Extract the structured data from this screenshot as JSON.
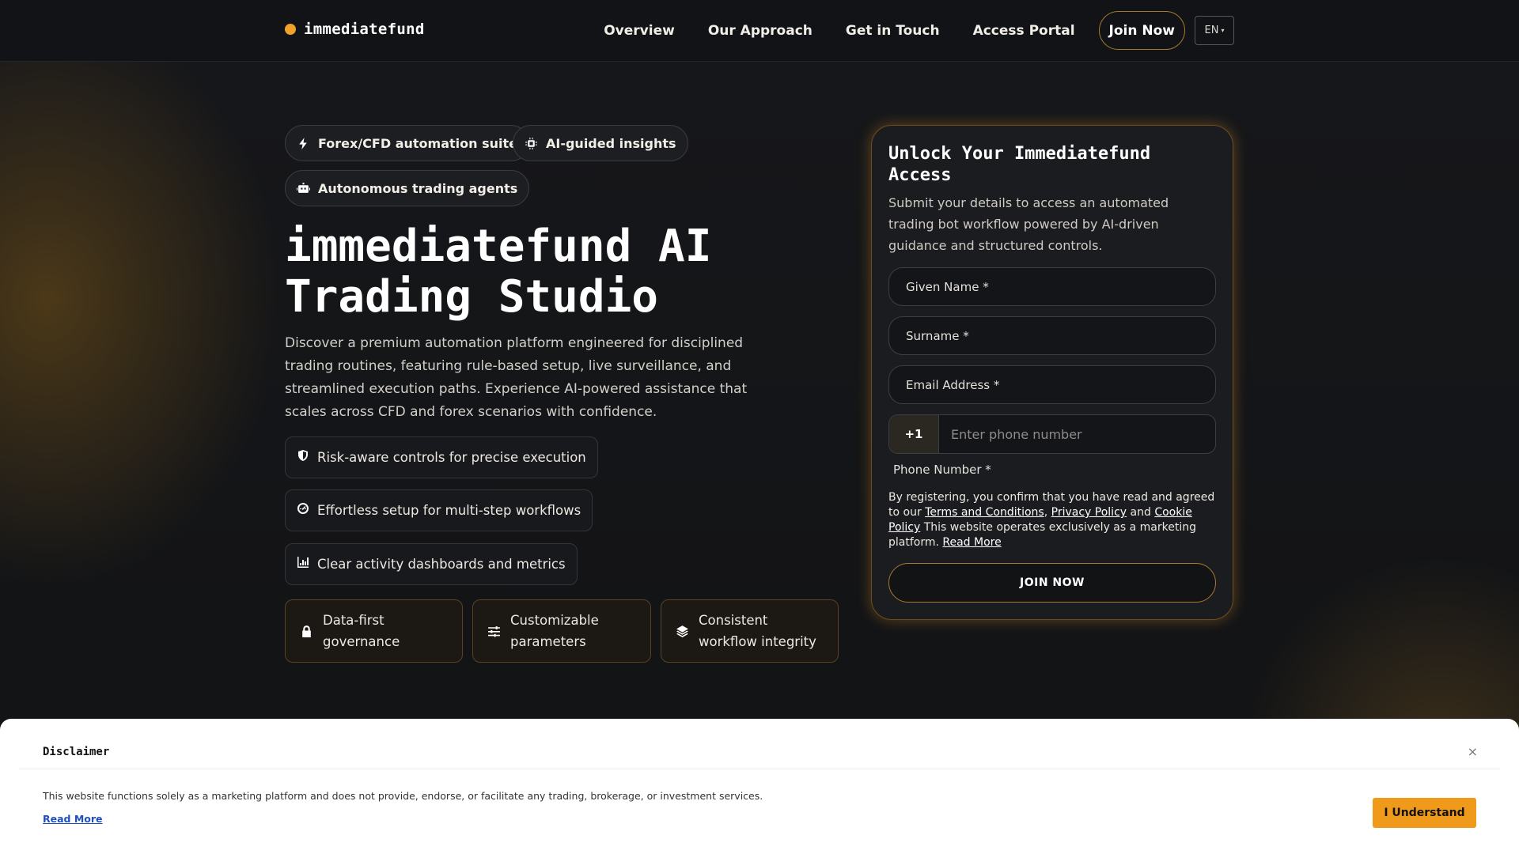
{
  "header": {
    "brand": "immediatefund",
    "nav": [
      "Overview",
      "Our Approach",
      "Get in Touch",
      "Access Portal"
    ],
    "join_label": "Join Now",
    "lang": "EN"
  },
  "hero": {
    "chips": [
      "Forex/CFD automation suite",
      "AI-guided insights",
      "Autonomous trading agents"
    ],
    "title": "immediatefund AI Trading Studio",
    "description": "Discover a premium automation platform engineered for disciplined trading routines, featuring rule-based setup, live surveillance, and streamlined execution paths. Experience AI-powered assistance that scales across CFD and forex scenarios with confidence.",
    "features": [
      "Risk-aware controls for precise execution",
      "Effortless setup for multi-step workflows",
      "Clear activity dashboards and metrics"
    ],
    "cards": [
      "Data-first governance",
      "Customizable parameters",
      "Consistent workflow integrity"
    ]
  },
  "form": {
    "title": "Unlock Your Immediatefund Access",
    "subtitle": "Submit your details to access an automated trading bot workflow powered by AI-driven guidance and structured controls.",
    "given_name": "Given Name *",
    "surname": "Surname *",
    "email": "Email Address *",
    "phone_code": "+1",
    "phone_placeholder": "Enter phone number",
    "phone_label": "Phone Number *",
    "consent_prefix": "By registering, you confirm that you have read and agreed to our",
    "terms": "Terms and Conditions",
    "privacy": "Privacy Policy",
    "and": "and",
    "cookie": "Cookie Policy",
    "consent_suffix": "This website operates exclusively as a marketing platform.",
    "read_more": "Read More",
    "submit": "JOIN NOW"
  },
  "disclaimer": {
    "title": "Disclaimer",
    "close": "×",
    "text": "This website functions solely as a marketing platform and does not provide, endorse, or facilitate any trading, brokerage, or investment services.",
    "read_more": "Read More",
    "button": "I Understand"
  },
  "colors": {
    "accent": "#f0a12a",
    "background": "#121315",
    "button": "#f09a1c"
  }
}
